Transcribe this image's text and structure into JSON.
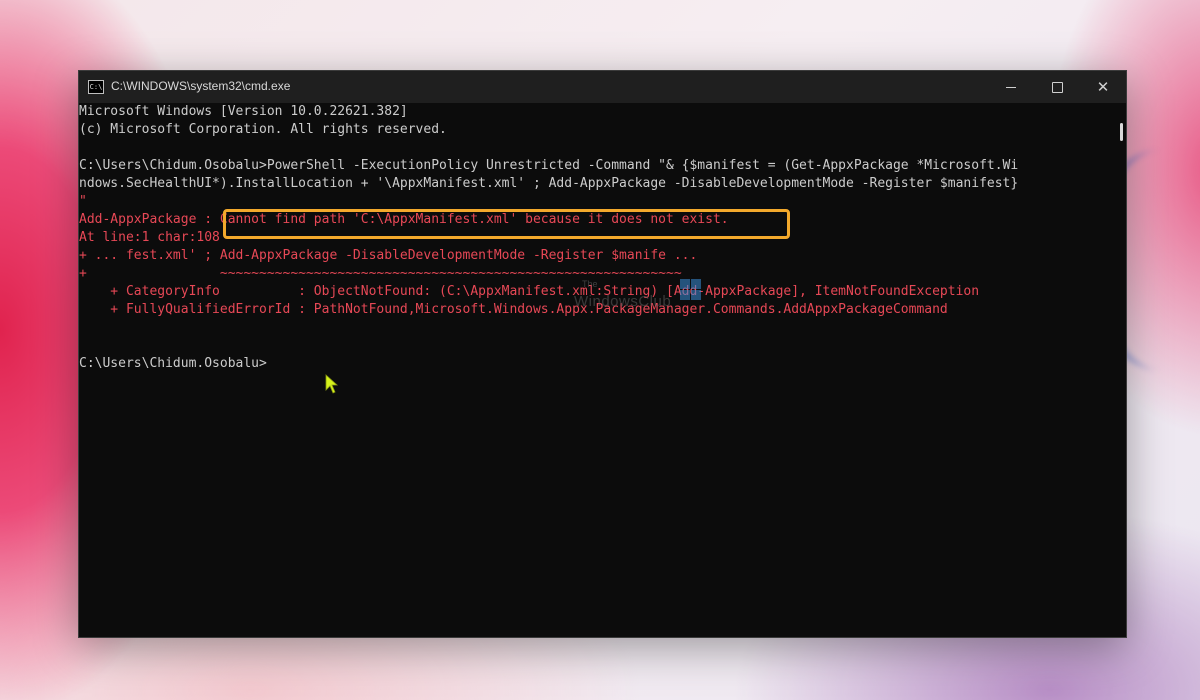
{
  "window": {
    "title": "C:\\WINDOWS\\system32\\cmd.exe",
    "icon": "cmd-icon",
    "icon_text": "C:\\"
  },
  "console": {
    "lines": [
      "Microsoft Windows [Version 10.0.22621.382]",
      "(c) Microsoft Corporation. All rights reserved.",
      "",
      "C:\\Users\\Chidum.Osobalu>PowerShell -ExecutionPolicy Unrestricted -Command \"& {$manifest = (Get-AppxPackage *Microsoft.Wi",
      "ndows.SecHealthUI*).InstallLocation + '\\AppxManifest.xml' ; Add-AppxPackage -DisableDevelopmentMode -Register $manifest}",
      "\"",
      "Add-AppxPackage : Cannot find path 'C:\\AppxManifest.xml' because it does not exist.",
      "At line:1 char:108",
      "+ ... fest.xml' ; Add-AppxPackage -DisableDevelopmentMode -Register $manife ...",
      "+                 ~~~~~~~~~~~~~~~~~~~~~~~~~~~~~~~~~~~~~~~~~~~~~~~~~~~~~~~~~~~",
      "    + CategoryInfo          : ObjectNotFound: (C:\\AppxManifest.xml:String) [Add-AppxPackage], ItemNotFoundException",
      "    + FullyQualifiedErrorId : PathNotFound,Microsoft.Windows.Appx.PackageManager.Commands.AddAppxPackageCommand",
      "",
      "",
      "C:\\Users\\Chidum.Osobalu>"
    ],
    "error_color": "#e74856",
    "text_color": "#cccccc",
    "highlight_color": "#f3a92c"
  },
  "watermark": {
    "small": "The",
    "main": "WindowsClub"
  }
}
